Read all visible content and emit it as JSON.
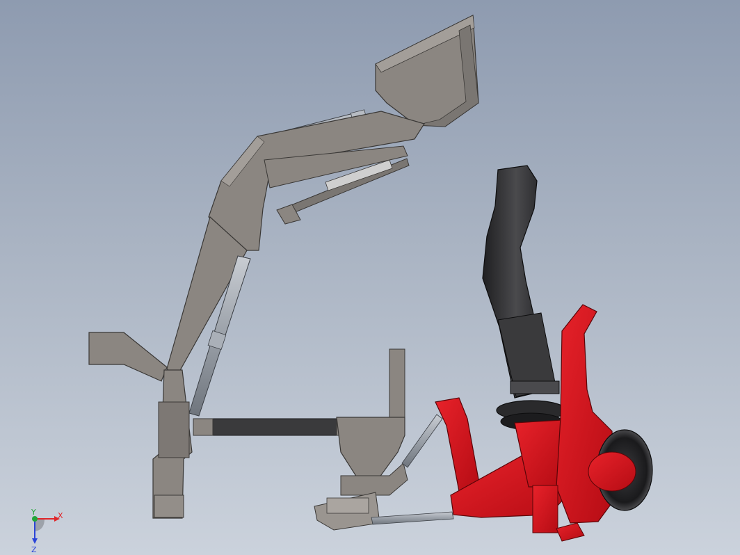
{
  "viewport": {
    "background_top": "#8e9bb0",
    "background_bottom": "#cbd2dc"
  },
  "model": {
    "loader_color": "#8b8681",
    "steel_dark_color": "#3a3a3c",
    "attachment_color": "#d0101a",
    "hose_color": "#2b2b2d",
    "components": [
      "loader-boom",
      "bucket",
      "bucket-cylinder",
      "lift-cylinder",
      "mount-bracket",
      "bucket-tilt-linkage",
      "lower-crossbar",
      "three-point-hitch",
      "red-attachment-frame",
      "black-chute-hose",
      "gear-ring",
      "wheel"
    ]
  },
  "triad": {
    "x_label": "X",
    "y_label": "Y",
    "z_label": "Z",
    "x_color": "#e0262a",
    "y_color": "#22a63a",
    "z_color": "#2a44d8"
  }
}
